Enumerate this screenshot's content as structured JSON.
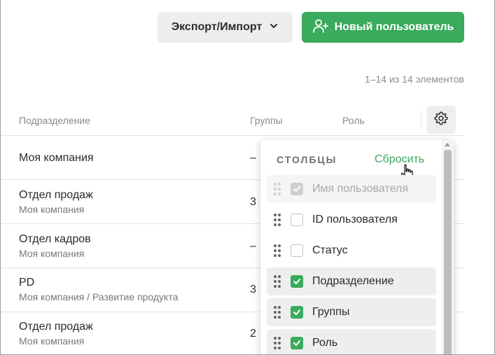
{
  "toolbar": {
    "export_label": "Экспорт/Импорт",
    "new_user_label": "Новый пользователь"
  },
  "pagination": {
    "summary": "1–14 из 14 элементов"
  },
  "table": {
    "columns": [
      "Подразделение",
      "Группы",
      "Роль"
    ],
    "rows": [
      {
        "department": "Моя компания",
        "path": "",
        "groups": "–"
      },
      {
        "department": "Отдел продаж",
        "path": "Моя компания",
        "groups": "3"
      },
      {
        "department": "Отдел кадров",
        "path": "Моя компания",
        "groups": "–"
      },
      {
        "department": "PD",
        "path": "Моя компания / Развитие продукта",
        "groups": "3"
      },
      {
        "department": "Отдел продаж",
        "path": "Моя компания",
        "groups": "2"
      }
    ]
  },
  "columns_panel": {
    "title": "СТОЛБЦЫ",
    "reset_label": "Сбросить",
    "items": [
      {
        "label": "Имя пользователя",
        "checked": true,
        "disabled": true
      },
      {
        "label": "ID пользователя",
        "checked": false,
        "disabled": false
      },
      {
        "label": "Статус",
        "checked": false,
        "disabled": false
      },
      {
        "label": "Подразделение",
        "checked": true,
        "disabled": false
      },
      {
        "label": "Группы",
        "checked": true,
        "disabled": false
      },
      {
        "label": "Роль",
        "checked": true,
        "disabled": false
      }
    ]
  },
  "colors": {
    "accent": "#3aaa5c",
    "button_bg": "#eeeeee",
    "muted_text": "#8a8a8a"
  }
}
